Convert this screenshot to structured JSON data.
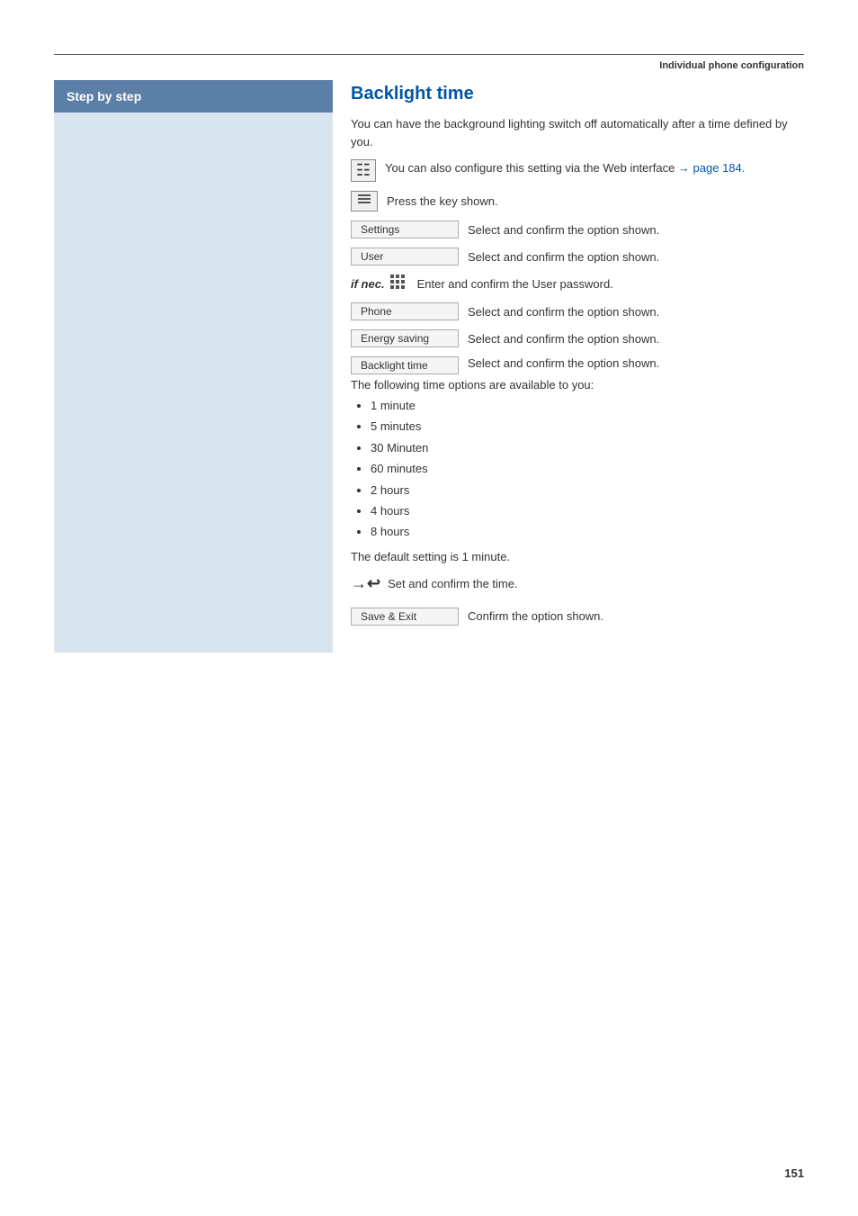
{
  "page": {
    "header": "Individual phone configuration",
    "page_number": "151"
  },
  "sidebar": {
    "title": "Step by step"
  },
  "section": {
    "title": "Backlight time",
    "intro": "You can have the background lighting switch off automatically after a time defined by you.",
    "web_note": "You can also configure this setting via the Web interface → page 184.",
    "web_ref": "page 184.",
    "arrow_ref": "→"
  },
  "rows": [
    {
      "id": "press-key",
      "left_type": "icon",
      "left_icon": "menu-icon",
      "right_text": "Press the key shown."
    },
    {
      "id": "settings",
      "left_type": "option",
      "left_label": "Settings",
      "right_text": "Select and confirm the option shown."
    },
    {
      "id": "user",
      "left_type": "option",
      "left_label": "User",
      "right_text": "Select and confirm the option shown."
    },
    {
      "id": "if-nec",
      "left_type": "if-nec",
      "left_label": "if nec.",
      "right_text": "Enter and confirm the User password."
    },
    {
      "id": "phone",
      "left_type": "option",
      "left_label": "Phone",
      "right_text": "Select and confirm the option shown."
    },
    {
      "id": "energy-saving",
      "left_type": "option",
      "left_label": "Energy saving",
      "right_text": "Select and confirm the option shown."
    },
    {
      "id": "backlight-time",
      "left_type": "option",
      "left_label": "Backlight time",
      "right_text": "Select and confirm the option shown."
    }
  ],
  "time_options": {
    "intro": "The following time options are available to you:",
    "items": [
      "1 minute",
      "5 minutes",
      "30 Minuten",
      "60 minutes",
      "2 hours",
      "4 hours",
      "8 hours"
    ]
  },
  "default_setting": "The default setting is 1 minute.",
  "set_time": {
    "left_type": "arrow-return",
    "right_text": "Set and confirm the time."
  },
  "save_exit": {
    "left_label": "Save & Exit",
    "right_text": "Confirm the option shown."
  }
}
